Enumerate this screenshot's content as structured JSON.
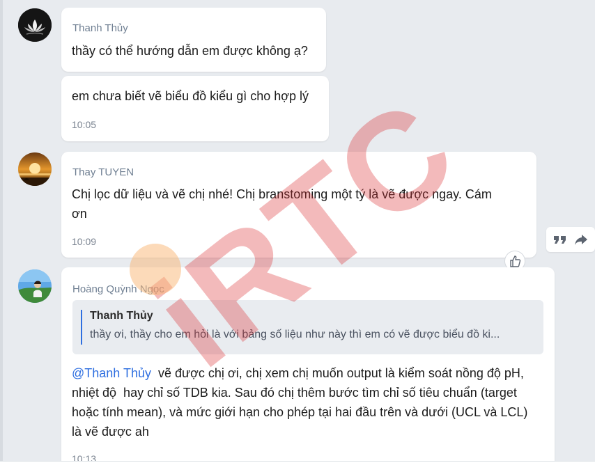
{
  "messages": [
    {
      "sender": "Thanh Thủy",
      "avatar_icon": "lotus-avatar-icon",
      "lines": [
        "thầy có thể hướng dẫn em được không ạ?",
        "em chưa biết vẽ biểu đồ kiểu gì cho hợp lý"
      ],
      "time": "10:05"
    },
    {
      "sender": "Thay TUYEN",
      "avatar_icon": "sunset-avatar-icon",
      "text_line1": "Chị lọc dữ liệu và vẽ chị nhé! Chị branstoming một tý là vẽ được ngay. Cám",
      "text_line2": "ơn",
      "time": "10:09"
    },
    {
      "sender": "Hoàng Quỳnh Ngọc",
      "avatar_icon": "person-avatar-icon",
      "quote": {
        "author": "Thanh Thủy",
        "text": "thầy ơi, thầy cho em hỏi là với bảng số liệu như này thì em có vẽ được biểu đồ ki..."
      },
      "mention": "@Thanh Thủy",
      "text_line1": "  vẽ được chị ơi, chị xem chị muốn output là kiểm soát nồng độ pH,",
      "text_line2": "nhiệt độ  hay chỉ số TDB kia. Sau đó chị thêm bước tìm chỉ số tiêu chuẩn (target",
      "text_line3": "hoặc tính mean), và mức giới hạn cho phép tại hai đầu trên và dưới (UCL và LCL)",
      "text_line4": "là vẽ được ah",
      "time": "10:13"
    }
  ],
  "actions": {
    "quote_icon": "quote-icon",
    "forward_icon": "forward-icon",
    "like_icon": "thumbs-up-icon"
  },
  "watermark": {
    "text": "iRTC"
  },
  "colors": {
    "mention": "#2f6fe0",
    "background": "#e8ebef",
    "watermark": "#dc2d32"
  }
}
